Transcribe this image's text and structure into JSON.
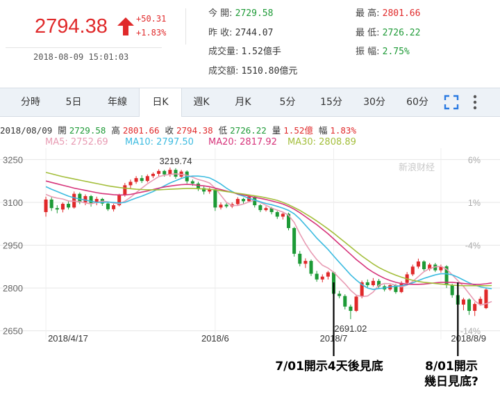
{
  "quote": {
    "price": "2794.38",
    "change": "+50.31",
    "change_pct": "+1.83%",
    "timestamp": "2018-08-09 15:01:03",
    "stats_left": [
      {
        "label": "今 開:",
        "value": "2729.58",
        "cls": "dn"
      },
      {
        "label": "昨 收:",
        "value": "2744.07",
        "cls": "flat"
      },
      {
        "label": "成交量:",
        "value": "1.52億手",
        "cls": "flat"
      },
      {
        "label": "成交額:",
        "value": "1510.80億元",
        "cls": "flat"
      }
    ],
    "stats_right": [
      {
        "label": "最 高:",
        "value": "2801.66",
        "cls": "up"
      },
      {
        "label": "最 低:",
        "value": "2726.22",
        "cls": "dn"
      },
      {
        "label": "振 幅:",
        "value": "2.75%",
        "cls": "dn"
      }
    ]
  },
  "tabs": [
    {
      "label": "分時",
      "active": false
    },
    {
      "label": "5日",
      "active": false
    },
    {
      "label": "年線",
      "active": false
    },
    {
      "label": "日K",
      "active": true
    },
    {
      "label": "週K",
      "active": false
    },
    {
      "label": "月K",
      "active": false
    },
    {
      "label": "5分",
      "active": false
    },
    {
      "label": "15分",
      "active": false
    },
    {
      "label": "30分",
      "active": false
    },
    {
      "label": "60分",
      "active": false
    }
  ],
  "icons": [
    "fullscreen-icon",
    "more-icon"
  ],
  "colors": {
    "up": "#e0292a",
    "down": "#1d9a36",
    "ma5": "#e89bb3",
    "ma10": "#3bbbe0",
    "ma20": "#d6337a",
    "ma30": "#a3be3a",
    "annotation": "#000000"
  },
  "info_bar": {
    "date": "2018/08/09",
    "open_label": "開",
    "open": "2729.58",
    "high_label": "高",
    "high": "2801.66",
    "close_label": "收",
    "close": "2794.38",
    "low_label": "低",
    "low": "2726.22",
    "vol_label": "量",
    "vol": "1.52億",
    "amp_label": "幅",
    "amp": "1.83%"
  },
  "ma_legend": [
    {
      "label": "MA5: 2752.69",
      "color": "#e89bb3"
    },
    {
      "label": "MA10: 2797.50",
      "color": "#3bbbe0"
    },
    {
      "label": "MA20: 2817.92",
      "color": "#d6337a"
    },
    {
      "label": "MA30: 2808.89",
      "color": "#a3be3a"
    }
  ],
  "watermark": "新浪财经",
  "chart_data": {
    "type": "candlestick",
    "y_ticks": [
      3250,
      3100,
      2950,
      2800,
      2650
    ],
    "y_range": [
      2620,
      3290
    ],
    "right_ticks": [
      {
        "label": "6%",
        "value": 3250
      },
      {
        "label": "1%",
        "value": 3100
      },
      {
        "label": "-4%",
        "value": 2950
      },
      {
        "label": "-14%",
        "value": 2650
      }
    ],
    "x_labels": [
      {
        "label": "2018/4/17",
        "index": 0
      },
      {
        "label": "2018/6",
        "index": 30
      },
      {
        "label": "2018/7",
        "index": 51
      },
      {
        "label": "2018/8/9",
        "index": 70
      }
    ],
    "grid": true,
    "candles": [
      [
        3066,
        3110,
        3050,
        3120
      ],
      [
        3110,
        3080,
        3070,
        3118
      ],
      [
        3080,
        3075,
        3062,
        3090
      ],
      [
        3075,
        3095,
        3065,
        3100
      ],
      [
        3095,
        3082,
        3075,
        3105
      ],
      [
        3082,
        3130,
        3078,
        3138
      ],
      [
        3130,
        3100,
        3094,
        3135
      ],
      [
        3100,
        3122,
        3090,
        3128
      ],
      [
        3122,
        3098,
        3085,
        3126
      ],
      [
        3098,
        3112,
        3090,
        3120
      ],
      [
        3112,
        3096,
        3088,
        3116
      ],
      [
        3096,
        3076,
        3070,
        3100
      ],
      [
        3076,
        3090,
        3068,
        3095
      ],
      [
        3090,
        3125,
        3086,
        3130
      ],
      [
        3125,
        3160,
        3120,
        3168
      ],
      [
        3160,
        3172,
        3150,
        3180
      ],
      [
        3172,
        3185,
        3165,
        3192
      ],
      [
        3185,
        3175,
        3168,
        3195
      ],
      [
        3175,
        3192,
        3170,
        3198
      ],
      [
        3192,
        3200,
        3185,
        3205
      ],
      [
        3200,
        3210,
        3192,
        3216
      ],
      [
        3210,
        3198,
        3190,
        3214
      ],
      [
        3198,
        3214,
        3190,
        3222
      ],
      [
        3214,
        3190,
        3183,
        3219.74
      ],
      [
        3190,
        3208,
        3184,
        3214
      ],
      [
        3208,
        3174,
        3166,
        3212
      ],
      [
        3174,
        3166,
        3158,
        3180
      ],
      [
        3166,
        3150,
        3140,
        3172
      ],
      [
        3150,
        3138,
        3128,
        3158
      ],
      [
        3138,
        3146,
        3130,
        3152
      ],
      [
        3146,
        3082,
        3070,
        3150
      ],
      [
        3082,
        3092,
        3075,
        3100
      ],
      [
        3092,
        3086,
        3080,
        3098
      ],
      [
        3086,
        3094,
        3080,
        3100
      ],
      [
        3094,
        3112,
        3088,
        3118
      ],
      [
        3112,
        3104,
        3096,
        3116
      ],
      [
        3104,
        3120,
        3100,
        3126
      ],
      [
        3120,
        3090,
        3082,
        3124
      ],
      [
        3090,
        3073,
        3066,
        3094
      ],
      [
        3073,
        3080,
        3068,
        3086
      ],
      [
        3080,
        3066,
        3058,
        3084
      ],
      [
        3066,
        3050,
        3042,
        3070
      ],
      [
        3050,
        3060,
        3040,
        3064
      ],
      [
        3060,
        3010,
        3002,
        3064
      ],
      [
        3010,
        2920,
        2910,
        3014
      ],
      [
        2920,
        2885,
        2876,
        2930
      ],
      [
        2885,
        2895,
        2870,
        2904
      ],
      [
        2895,
        2850,
        2842,
        2900
      ],
      [
        2850,
        2830,
        2822,
        2860
      ],
      [
        2830,
        2840,
        2820,
        2848
      ],
      [
        2840,
        2855,
        2830,
        2860
      ],
      [
        2855,
        2780,
        2770,
        2858
      ],
      [
        2780,
        2772,
        2764,
        2790
      ],
      [
        2772,
        2735,
        2725,
        2778
      ],
      [
        2735,
        2720,
        2691.02,
        2742
      ],
      [
        2720,
        2770,
        2716,
        2775
      ],
      [
        2770,
        2820,
        2764,
        2826
      ],
      [
        2820,
        2810,
        2802,
        2830
      ],
      [
        2810,
        2825,
        2805,
        2835
      ],
      [
        2825,
        2806,
        2798,
        2832
      ],
      [
        2806,
        2795,
        2788,
        2812
      ],
      [
        2795,
        2810,
        2790,
        2815
      ],
      [
        2810,
        2786,
        2780,
        2814
      ],
      [
        2786,
        2818,
        2782,
        2824
      ],
      [
        2818,
        2848,
        2814,
        2856
      ],
      [
        2848,
        2875,
        2842,
        2882
      ],
      [
        2875,
        2893,
        2868,
        2903
      ],
      [
        2893,
        2866,
        2860,
        2897
      ],
      [
        2866,
        2882,
        2860,
        2888
      ],
      [
        2882,
        2862,
        2856,
        2888
      ],
      [
        2862,
        2876,
        2854,
        2882
      ],
      [
        2876,
        2810,
        2800,
        2880
      ],
      [
        2810,
        2775,
        2766,
        2815
      ],
      [
        2775,
        2742,
        2730,
        2780
      ],
      [
        2742,
        2760,
        2722,
        2766
      ],
      [
        2760,
        2720,
        2706,
        2764
      ],
      [
        2720,
        2744,
        2702,
        2750
      ],
      [
        2744,
        2762,
        2738,
        2770
      ],
      [
        2729.58,
        2794.38,
        2726.22,
        2801.66
      ]
    ],
    "ma_series": [
      {
        "name": "MA5",
        "values": [
          3128,
          3120,
          3115,
          3112,
          3105,
          3104,
          3103,
          3098,
          3095,
          3100,
          3104,
          3102,
          3098,
          3095,
          3104,
          3118,
          3134,
          3150,
          3165,
          3178,
          3190,
          3195,
          3198,
          3200,
          3198,
          3195,
          3188,
          3180,
          3175,
          3168,
          3150,
          3125,
          3100,
          3089,
          3089,
          3094,
          3102,
          3108,
          3100,
          3090,
          3080,
          3073,
          3066,
          3055,
          3030,
          2990,
          2955,
          2925,
          2900,
          2880,
          2870,
          2855,
          2835,
          2815,
          2792,
          2775,
          2770,
          2772,
          2786,
          2810,
          2816,
          2815,
          2810,
          2804,
          2810,
          2823,
          2840,
          2857,
          2868,
          2874,
          2876,
          2866,
          2846,
          2826,
          2806,
          2780,
          2755,
          2740,
          2745,
          2752.69
        ]
      },
      {
        "name": "MA10",
        "values": [
          3155,
          3146,
          3138,
          3130,
          3122,
          3116,
          3112,
          3108,
          3104,
          3100,
          3100,
          3101,
          3100,
          3098,
          3100,
          3108,
          3115,
          3122,
          3130,
          3138,
          3148,
          3158,
          3168,
          3176,
          3184,
          3190,
          3192,
          3192,
          3190,
          3186,
          3176,
          3164,
          3150,
          3138,
          3128,
          3122,
          3114,
          3108,
          3102,
          3096,
          3092,
          3086,
          3080,
          3072,
          3060,
          3042,
          3020,
          2998,
          2975,
          2955,
          2935,
          2912,
          2890,
          2868,
          2846,
          2828,
          2812,
          2800,
          2795,
          2798,
          2800,
          2804,
          2806,
          2808,
          2812,
          2818,
          2826,
          2834,
          2840,
          2846,
          2850,
          2850,
          2846,
          2838,
          2828,
          2818,
          2810,
          2804,
          2800,
          2797.5
        ]
      },
      {
        "name": "MA20",
        "values": [
          3175,
          3170,
          3165,
          3160,
          3155,
          3150,
          3146,
          3142,
          3138,
          3134,
          3131,
          3129,
          3127,
          3126,
          3126,
          3128,
          3132,
          3136,
          3140,
          3145,
          3150,
          3154,
          3157,
          3160,
          3162,
          3163,
          3162,
          3160,
          3158,
          3155,
          3150,
          3145,
          3140,
          3135,
          3130,
          3126,
          3122,
          3118,
          3114,
          3110,
          3105,
          3100,
          3094,
          3086,
          3076,
          3064,
          3050,
          3036,
          3022,
          3006,
          2990,
          2972,
          2954,
          2936,
          2918,
          2900,
          2884,
          2868,
          2855,
          2844,
          2834,
          2826,
          2820,
          2816,
          2814,
          2813,
          2813,
          2814,
          2816,
          2818,
          2820,
          2820,
          2820,
          2818,
          2816,
          2814,
          2813,
          2813,
          2815,
          2817.92
        ]
      },
      {
        "name": "MA30",
        "values": [
          3205,
          3200,
          3195,
          3190,
          3186,
          3182,
          3178,
          3174,
          3170,
          3166,
          3162,
          3158,
          3155,
          3152,
          3150,
          3148,
          3146,
          3145,
          3144,
          3144,
          3144,
          3145,
          3146,
          3147,
          3148,
          3149,
          3149,
          3148,
          3147,
          3146,
          3144,
          3141,
          3138,
          3135,
          3132,
          3129,
          3126,
          3123,
          3120,
          3116,
          3112,
          3107,
          3100,
          3092,
          3082,
          3072,
          3060,
          3048,
          3035,
          3021,
          3007,
          2992,
          2976,
          2960,
          2944,
          2928,
          2912,
          2898,
          2884,
          2872,
          2862,
          2853,
          2845,
          2838,
          2832,
          2827,
          2823,
          2820,
          2818,
          2816,
          2814,
          2812,
          2810,
          2809,
          2808,
          2808,
          2808,
          2808,
          2808,
          2808.89
        ]
      }
    ],
    "labels": [
      {
        "text": "3219.74",
        "index": 23,
        "value": 3219.74,
        "anchor": "top"
      },
      {
        "text": "2691.02",
        "index": 54,
        "value": 2691.02,
        "anchor": "bottom"
      }
    ],
    "annotations": [
      {
        "text": "7/01開示4天後見底",
        "lines": [
          "7/01開示4天後見底"
        ],
        "index": 51
      },
      {
        "text": "8/01開示\n幾日見底?",
        "lines": [
          "8/01開示",
          "幾日見底?"
        ],
        "index": 73
      }
    ]
  }
}
